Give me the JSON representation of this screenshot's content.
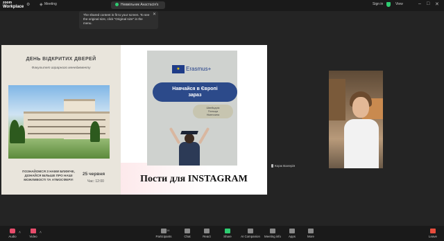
{
  "app": {
    "logo_line1": "zoom",
    "logo_line2": "Workplace",
    "meeting_label": "Meeting",
    "share_pill": "Невмільник Анастасія's scre",
    "signin": "Sign in",
    "view": "View"
  },
  "tooltip": {
    "text": "The shared content is fit to your screen. To see the original size, click \"Original size\" in the menu."
  },
  "slide": {
    "left": {
      "title": "ДЕНЬ ВІДКРИТИХ ДВЕРЕЙ",
      "subtitle": "Факультет аграрного менеджменту",
      "body_line1": "ПОЗНАЙОМСЯ З НАМИ БЛИЖЧЕ,",
      "body_line2": "ДІЗНАЙСЯ БІЛЬШЕ ПРО НАШІ",
      "body_line3": "МОЖЛИВОСТІ ТА АТМОСФЕРУ!",
      "date": "25 червня",
      "time": "Час: 12:00"
    },
    "right": {
      "erasmus": "Erasmus+",
      "headline_line1": "Навчайся в Європі",
      "headline_line2": "зараз",
      "countries_line1": "Швейцарія",
      "countries_line2": "Польща",
      "countries_line3": "Німеччина",
      "caption": "Пости для INSTAGRAM"
    }
  },
  "participant": {
    "name": "Корж Валерія"
  },
  "toolbar": {
    "audio": "Audio",
    "video": "Video",
    "participants": "Participants",
    "participants_count": "14",
    "chat": "Chat",
    "react": "React",
    "share": "Share",
    "ai_companion": "AI Companion",
    "meeting_info": "Meeting info",
    "apps": "Apps",
    "more": "More",
    "leave": "Leave"
  },
  "colors": {
    "accent_green": "#2ecc71",
    "muted_red": "#e74c6b",
    "erasmus_blue": "#2c4a8a"
  }
}
